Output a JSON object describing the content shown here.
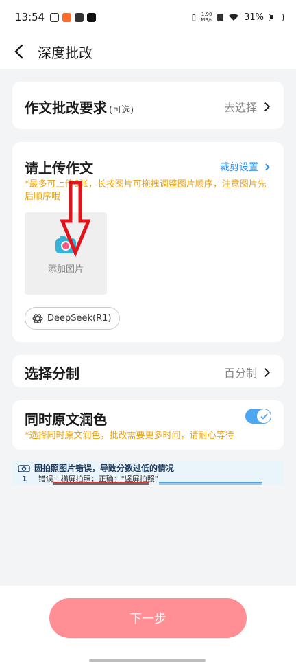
{
  "status_bar": {
    "time": "13:54",
    "net_speed_value": "1.90",
    "net_speed_unit": "MB/s",
    "battery": "31%"
  },
  "nav": {
    "title": "深度批改"
  },
  "requirements": {
    "title": "作文批改要求",
    "optional": "(可选)",
    "action": "去选择"
  },
  "upload": {
    "title": "请上传作文",
    "crop_settings": "裁剪设置",
    "hint_line1": "*最多可上传6张，长按图片可拖拽调整图片顺序，注意图片先",
    "hint_line2": "后顺序哦",
    "add_image": "添加图片",
    "model": "DeepSeek(R1)"
  },
  "grading": {
    "title": "选择分制",
    "value": "百分制"
  },
  "polish": {
    "title": "同时原文润色",
    "enabled": true,
    "hint": "*选择同时原文润色，批改需要更多时间，请耐心等待"
  },
  "banner": {
    "heading": "因拍照图片错误，导致分数过低的情况",
    "number": "1",
    "wrong": "错误：横屏拍照；正确：\"竖屏拍照\""
  },
  "footer": {
    "next_label": "下一步"
  },
  "colors": {
    "accent_blue": "#2a8be8",
    "hint_orange": "#e8a319",
    "button_pink": "#ff8e95",
    "toggle_blue": "#4da6f0"
  }
}
